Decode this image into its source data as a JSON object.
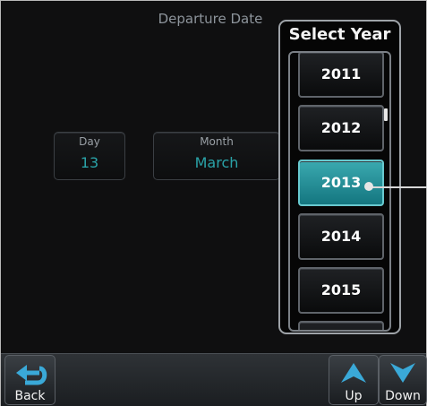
{
  "header": {
    "title": "Departure Date"
  },
  "fields": {
    "day": {
      "label": "Day",
      "value": "13"
    },
    "month": {
      "label": "Month",
      "value": "March"
    }
  },
  "popup": {
    "title": "Select Year",
    "years": [
      "2011",
      "2012",
      "2013",
      "2014",
      "2015"
    ],
    "selected": "2013"
  },
  "softkeys": {
    "back": "Back",
    "up": "Up",
    "down": "Down"
  },
  "colors": {
    "accent": "#2aa3a8",
    "selected_bg": "#1f8f97",
    "text": "#ffffff"
  }
}
